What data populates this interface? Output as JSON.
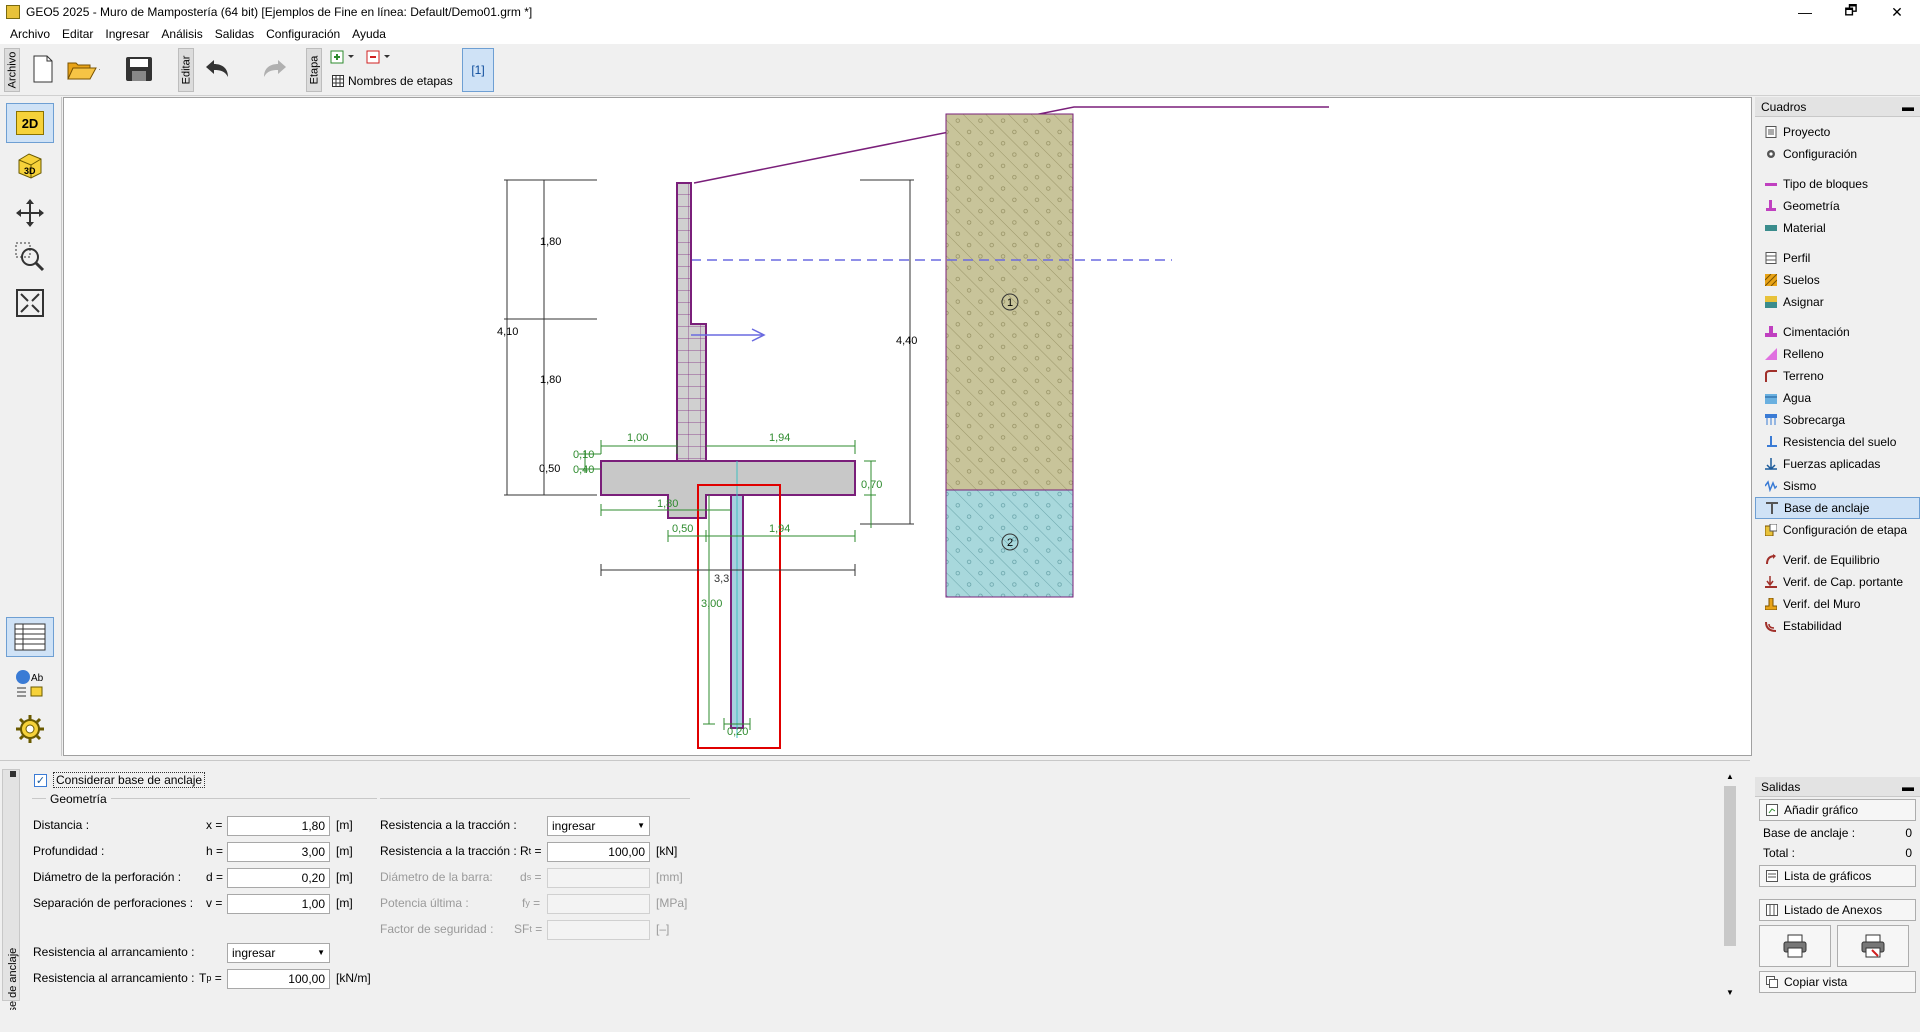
{
  "window": {
    "title": "GEO5 2025 - Muro de Mampostería (64 bit) [Ejemplos de Fine en línea: Default/Demo01.grm *]",
    "minimize": "—",
    "maximize": "🗗",
    "close": "✕"
  },
  "menu": [
    "Archivo",
    "Editar",
    "Ingresar",
    "Análisis",
    "Salidas",
    "Configuración",
    "Ayuda"
  ],
  "toolbar": {
    "archivo_tab": "Archivo",
    "editar_tab": "Editar",
    "etapa_tab": "Etapa",
    "stage_names_label": "Nombres de etapas",
    "stage_button": "[1]"
  },
  "leftbar": {
    "view_2d": "2D",
    "view_3d": "3D"
  },
  "drawing": {
    "dims": {
      "d_180a": "1,80",
      "d_180b": "1,80",
      "d_410": "4,10",
      "d_050": "0,50",
      "d_010": "0,10",
      "d_040": "0,40",
      "d_100": "1,00",
      "d_194a": "1,94",
      "d_070": "0,70",
      "d_440": "4,40",
      "d_180c": "1,80",
      "d_050b": "0,50",
      "d_194b": "1,94",
      "d_3x": "3,3",
      "d_300": "3,00",
      "d_020": "0,20"
    },
    "soil_labels": [
      "1",
      "2"
    ],
    "colors": {
      "wall_outline": "#7a1f7a",
      "wall_fill": "#c8c8c8",
      "dim": "#2e8b2e",
      "soil1": "#c8c49a",
      "soil2": "#a8d8dc",
      "water": "#6a6ae0",
      "highlight": "#e00000"
    }
  },
  "cuadros": {
    "header": "Cuadros",
    "items": [
      {
        "label": "Proyecto",
        "icon": "document-icon"
      },
      {
        "label": "Configuración",
        "icon": "gear-icon"
      },
      {
        "label": "Tipo de bloques",
        "icon": "blocks-icon"
      },
      {
        "label": "Geometría",
        "icon": "geometry-icon"
      },
      {
        "label": "Material",
        "icon": "material-icon"
      },
      {
        "label": "Perfil",
        "icon": "profile-icon"
      },
      {
        "label": "Suelos",
        "icon": "soils-icon"
      },
      {
        "label": "Asignar",
        "icon": "assign-icon"
      },
      {
        "label": "Cimentación",
        "icon": "foundation-icon"
      },
      {
        "label": "Relleno",
        "icon": "backfill-icon"
      },
      {
        "label": "Terreno",
        "icon": "terrain-icon"
      },
      {
        "label": "Agua",
        "icon": "water-icon"
      },
      {
        "label": "Sobrecarga",
        "icon": "surcharge-icon"
      },
      {
        "label": "Resistencia del suelo",
        "icon": "soil-resistance-icon"
      },
      {
        "label": "Fuerzas aplicadas",
        "icon": "forces-icon"
      },
      {
        "label": "Sismo",
        "icon": "earthquake-icon"
      },
      {
        "label": "Base de anclaje",
        "icon": "anchor-base-icon"
      },
      {
        "label": "Configuración de etapa",
        "icon": "stage-config-icon"
      },
      {
        "label": "Verif. de Equilibrio",
        "icon": "equilibrium-icon"
      },
      {
        "label": "Verif. de Cap. portante",
        "icon": "bearing-icon"
      },
      {
        "label": "Verif. del Muro",
        "icon": "wall-check-icon"
      },
      {
        "label": "Estabilidad",
        "icon": "stability-icon"
      }
    ]
  },
  "form": {
    "side_tab": "Base de anclaje",
    "consider_label": "Considerar base de anclaje",
    "consider_checked": "✓",
    "geometria_title": "Geometría",
    "distancia": {
      "label": "Distancia :",
      "sym": "x =",
      "value": "1,80",
      "unit": "[m]"
    },
    "profundidad": {
      "label": "Profundidad :",
      "sym": "h =",
      "value": "3,00",
      "unit": "[m]"
    },
    "diametro": {
      "label": "Diámetro de la perforación :",
      "sym": "d =",
      "value": "0,20",
      "unit": "[m]"
    },
    "separacion": {
      "label": "Separación de perforaciones :",
      "sym": "v =",
      "value": "1,00",
      "unit": "[m]"
    },
    "res_traccion_mode": {
      "label": "Resistencia a la tracción :",
      "value": "ingresar"
    },
    "res_traccion": {
      "label": "Resistencia a la tracción :",
      "sym": "R",
      "sub": "t",
      "value": "100,00",
      "unit": "[kN]"
    },
    "diam_barra": {
      "label": "Diámetro de la barra:",
      "sym": "d",
      "sub": "s",
      "unit": "[mm]"
    },
    "potencia": {
      "label": "Potencia última :",
      "sym": "f",
      "sub": "y",
      "unit": "[MPa]"
    },
    "factor": {
      "label": "Factor de seguridad :",
      "sym": "SF",
      "sub": "t",
      "unit": "[–]"
    },
    "res_arr_mode": {
      "label": "Resistencia al arrancamiento :",
      "value": "ingresar"
    },
    "res_arr": {
      "label": "Resistencia al arrancamiento :",
      "sym": "T",
      "sub": "p",
      "value": "100,00",
      "unit": "[kN/m]"
    }
  },
  "salidas": {
    "header": "Salidas",
    "add_graph": "Añadir gráfico",
    "base_label": "Base de anclaje :",
    "base_count": "0",
    "total_label": "Total :",
    "total_count": "0",
    "graph_list": "Lista de gráficos",
    "annex_list": "Listado de Anexos",
    "copy_view": "Copiar vista"
  }
}
